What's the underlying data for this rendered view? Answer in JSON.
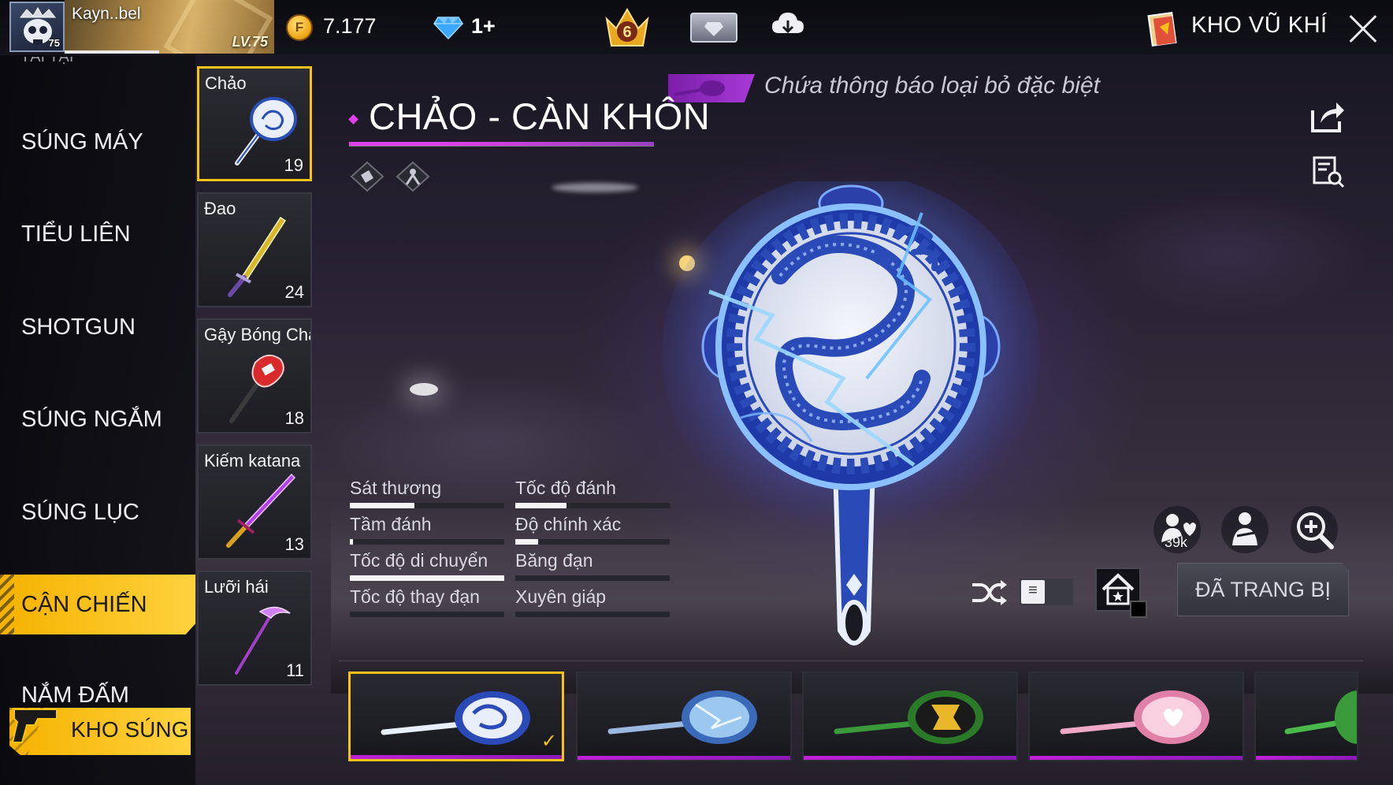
{
  "player": {
    "name": "Kayn..bel",
    "level": "LV.75",
    "avatar_level": "75"
  },
  "currency": {
    "coins": "7.177",
    "coin_glyph": "F",
    "diamonds": "1+"
  },
  "rank": {
    "value": "6"
  },
  "header": {
    "title": "KHO VŨ KHÍ"
  },
  "categories": [
    {
      "label": "SÚNG MÁY",
      "active": false
    },
    {
      "label": "TIỂU LIÊN",
      "active": false
    },
    {
      "label": "SHOTGUN",
      "active": false
    },
    {
      "label": "SÚNG NGẮM",
      "active": false
    },
    {
      "label": "SÚNG LỤC",
      "active": false
    },
    {
      "label": "CẬN CHIẾN",
      "active": true
    },
    {
      "label": "NẮM ĐẤM",
      "active": false
    }
  ],
  "category_cut_label": "TÁI TẠI",
  "armory_button": {
    "label": "KHO SÚNG"
  },
  "weapons": [
    {
      "name": "Chảo",
      "count": "19",
      "selected": true
    },
    {
      "name": "Đao",
      "count": "24",
      "selected": false
    },
    {
      "name": "Gậy Bóng Chày",
      "count": "18",
      "selected": false
    },
    {
      "name": "Kiếm katana",
      "count": "13",
      "selected": false
    },
    {
      "name": "Lưỡi hái",
      "count": "11",
      "selected": false
    }
  ],
  "notice": {
    "text": "Chứa thông báo loại bỏ đặc biệt"
  },
  "weapon_title": "CHẢO - CÀN KHÔN",
  "stats": [
    {
      "label": "Sát thương",
      "value": 0.42
    },
    {
      "label": "Tốc độ đánh",
      "value": 0.33
    },
    {
      "label": "Tầm đánh",
      "value": 0.02
    },
    {
      "label": "Độ chính xác",
      "value": 0.15
    },
    {
      "label": "Tốc độ di chuyển",
      "value": 1.0
    },
    {
      "label": "Băng đạn",
      "value": 0.0
    },
    {
      "label": "Tốc độ thay đạn",
      "value": 0.0
    },
    {
      "label": "Xuyên giáp",
      "value": 0.0
    }
  ],
  "likes": "39k",
  "equip_button": {
    "label": "ĐÃ TRANG BỊ"
  },
  "skins": [
    {
      "name": "dragon-porcelain",
      "selected": true,
      "color": "#d8e4f8"
    },
    {
      "name": "ice-blue",
      "selected": false,
      "color": "#9cc8f0"
    },
    {
      "name": "green-gold",
      "selected": false,
      "color": "#3a9a3a"
    },
    {
      "name": "pink-heart",
      "selected": false,
      "color": "#f0a8c8"
    },
    {
      "name": "green-partial",
      "selected": false,
      "color": "#4ab84a"
    }
  ],
  "colors": {
    "accent_yellow": "#f5c21a",
    "accent_purple": "#c020d8",
    "panel": "#1c1c22"
  }
}
